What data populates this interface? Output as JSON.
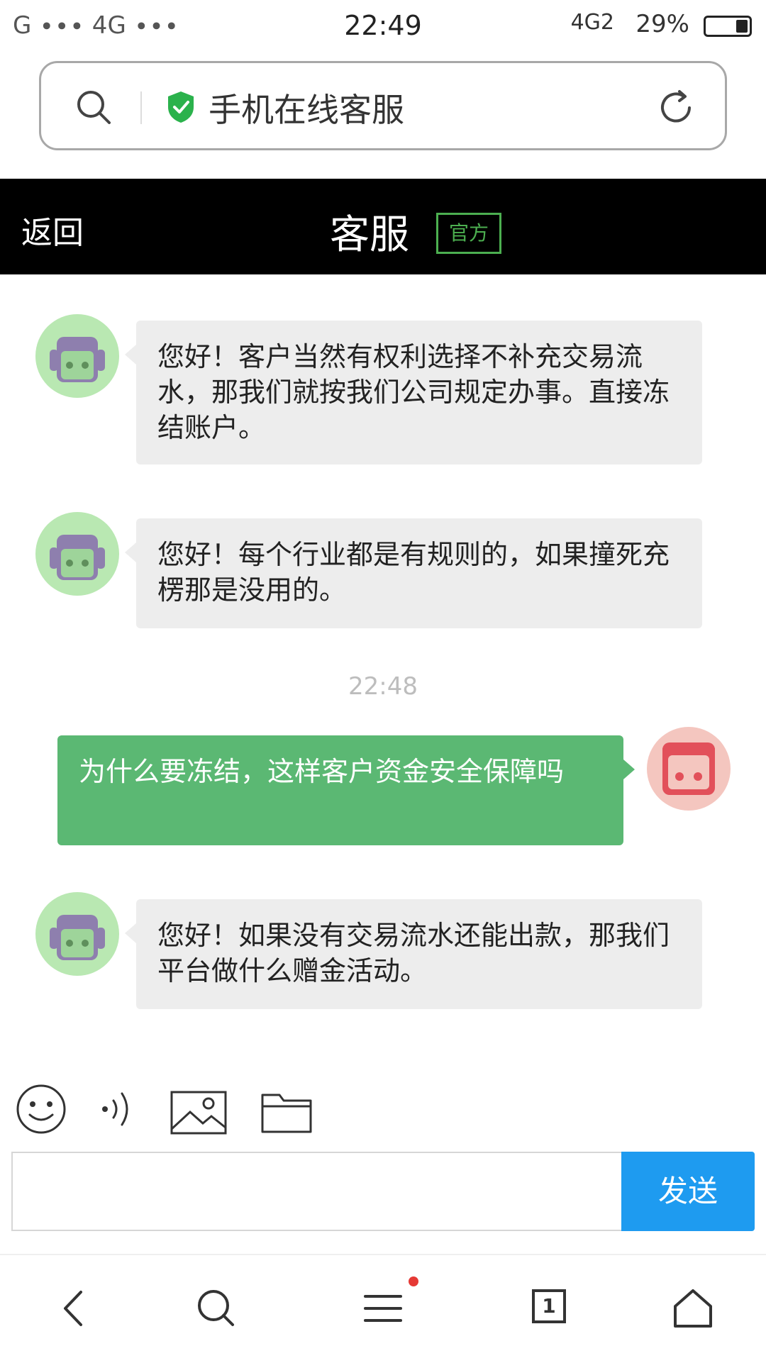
{
  "status_bar": {
    "signal_left": "G ∙∙∙  4G ∙∙∙",
    "time": "22:49",
    "network": "4G2",
    "battery_percent_text": "29%",
    "battery_level": 0.29
  },
  "address_bar": {
    "title": "手机在线客服"
  },
  "header": {
    "back_label": "返回",
    "title": "客服",
    "badge": "官方"
  },
  "chat": {
    "messages": [
      {
        "from": "agent",
        "text": "您好！客户当然有权利选择不补充交易流水，那我们就按我们公司规定办事。直接冻结账户。"
      },
      {
        "from": "agent",
        "text": "您好！每个行业都是有规则的，如果撞死充楞那是没用的。"
      },
      {
        "from": "user",
        "text": "为什么要冻结，这样客户资金安全保障吗"
      },
      {
        "from": "agent",
        "text": "您好！如果没有交易流水还能出款，那我们平台做什么赠金活动。"
      }
    ],
    "timestamp": "22:48"
  },
  "composer": {
    "input_value": "",
    "send_label": "发送"
  },
  "bottom_nav": {
    "tab_count": "1"
  },
  "colors": {
    "header_bg": "#000000",
    "badge_green": "#4caf50",
    "user_bubble": "#5bb873",
    "agent_bubble": "#ededed",
    "send_button": "#1e9bf0"
  }
}
